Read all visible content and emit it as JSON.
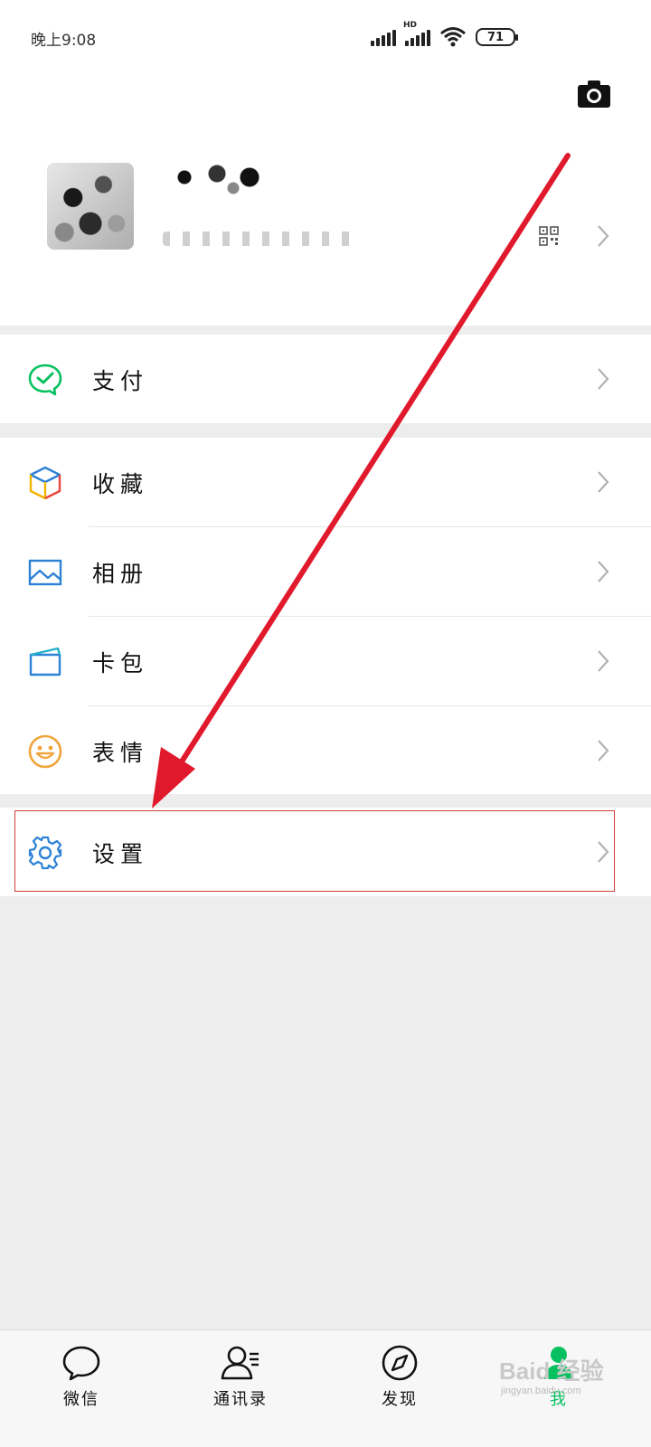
{
  "status_bar": {
    "time": "晚上9:08",
    "hd_label": "HD",
    "battery": "71"
  },
  "icons": {
    "camera": "camera-icon",
    "qr": "qr-code-icon",
    "pay": "wechat-pay-icon",
    "favorites": "cube-icon",
    "album": "image-icon",
    "cards": "card-wallet-icon",
    "stickers": "smiley-icon",
    "settings": "gear-icon",
    "chevron": "chevron-right-icon"
  },
  "colors": {
    "accent_green": "#07c160",
    "highlight_red": "#d23c3c",
    "arrow_red": "#e0192c",
    "icon_blue": "#2d82d6"
  },
  "menu": {
    "pay": "支付",
    "favorites": "收藏",
    "album": "相册",
    "cards": "卡包",
    "stickers": "表情",
    "settings": "设置"
  },
  "tabs": [
    {
      "label": "微信"
    },
    {
      "label": "通讯录"
    },
    {
      "label": "发现"
    },
    {
      "label": "我"
    }
  ],
  "watermark": {
    "main": "Baid 经验",
    "sub": "jingyan.baidu.com"
  }
}
